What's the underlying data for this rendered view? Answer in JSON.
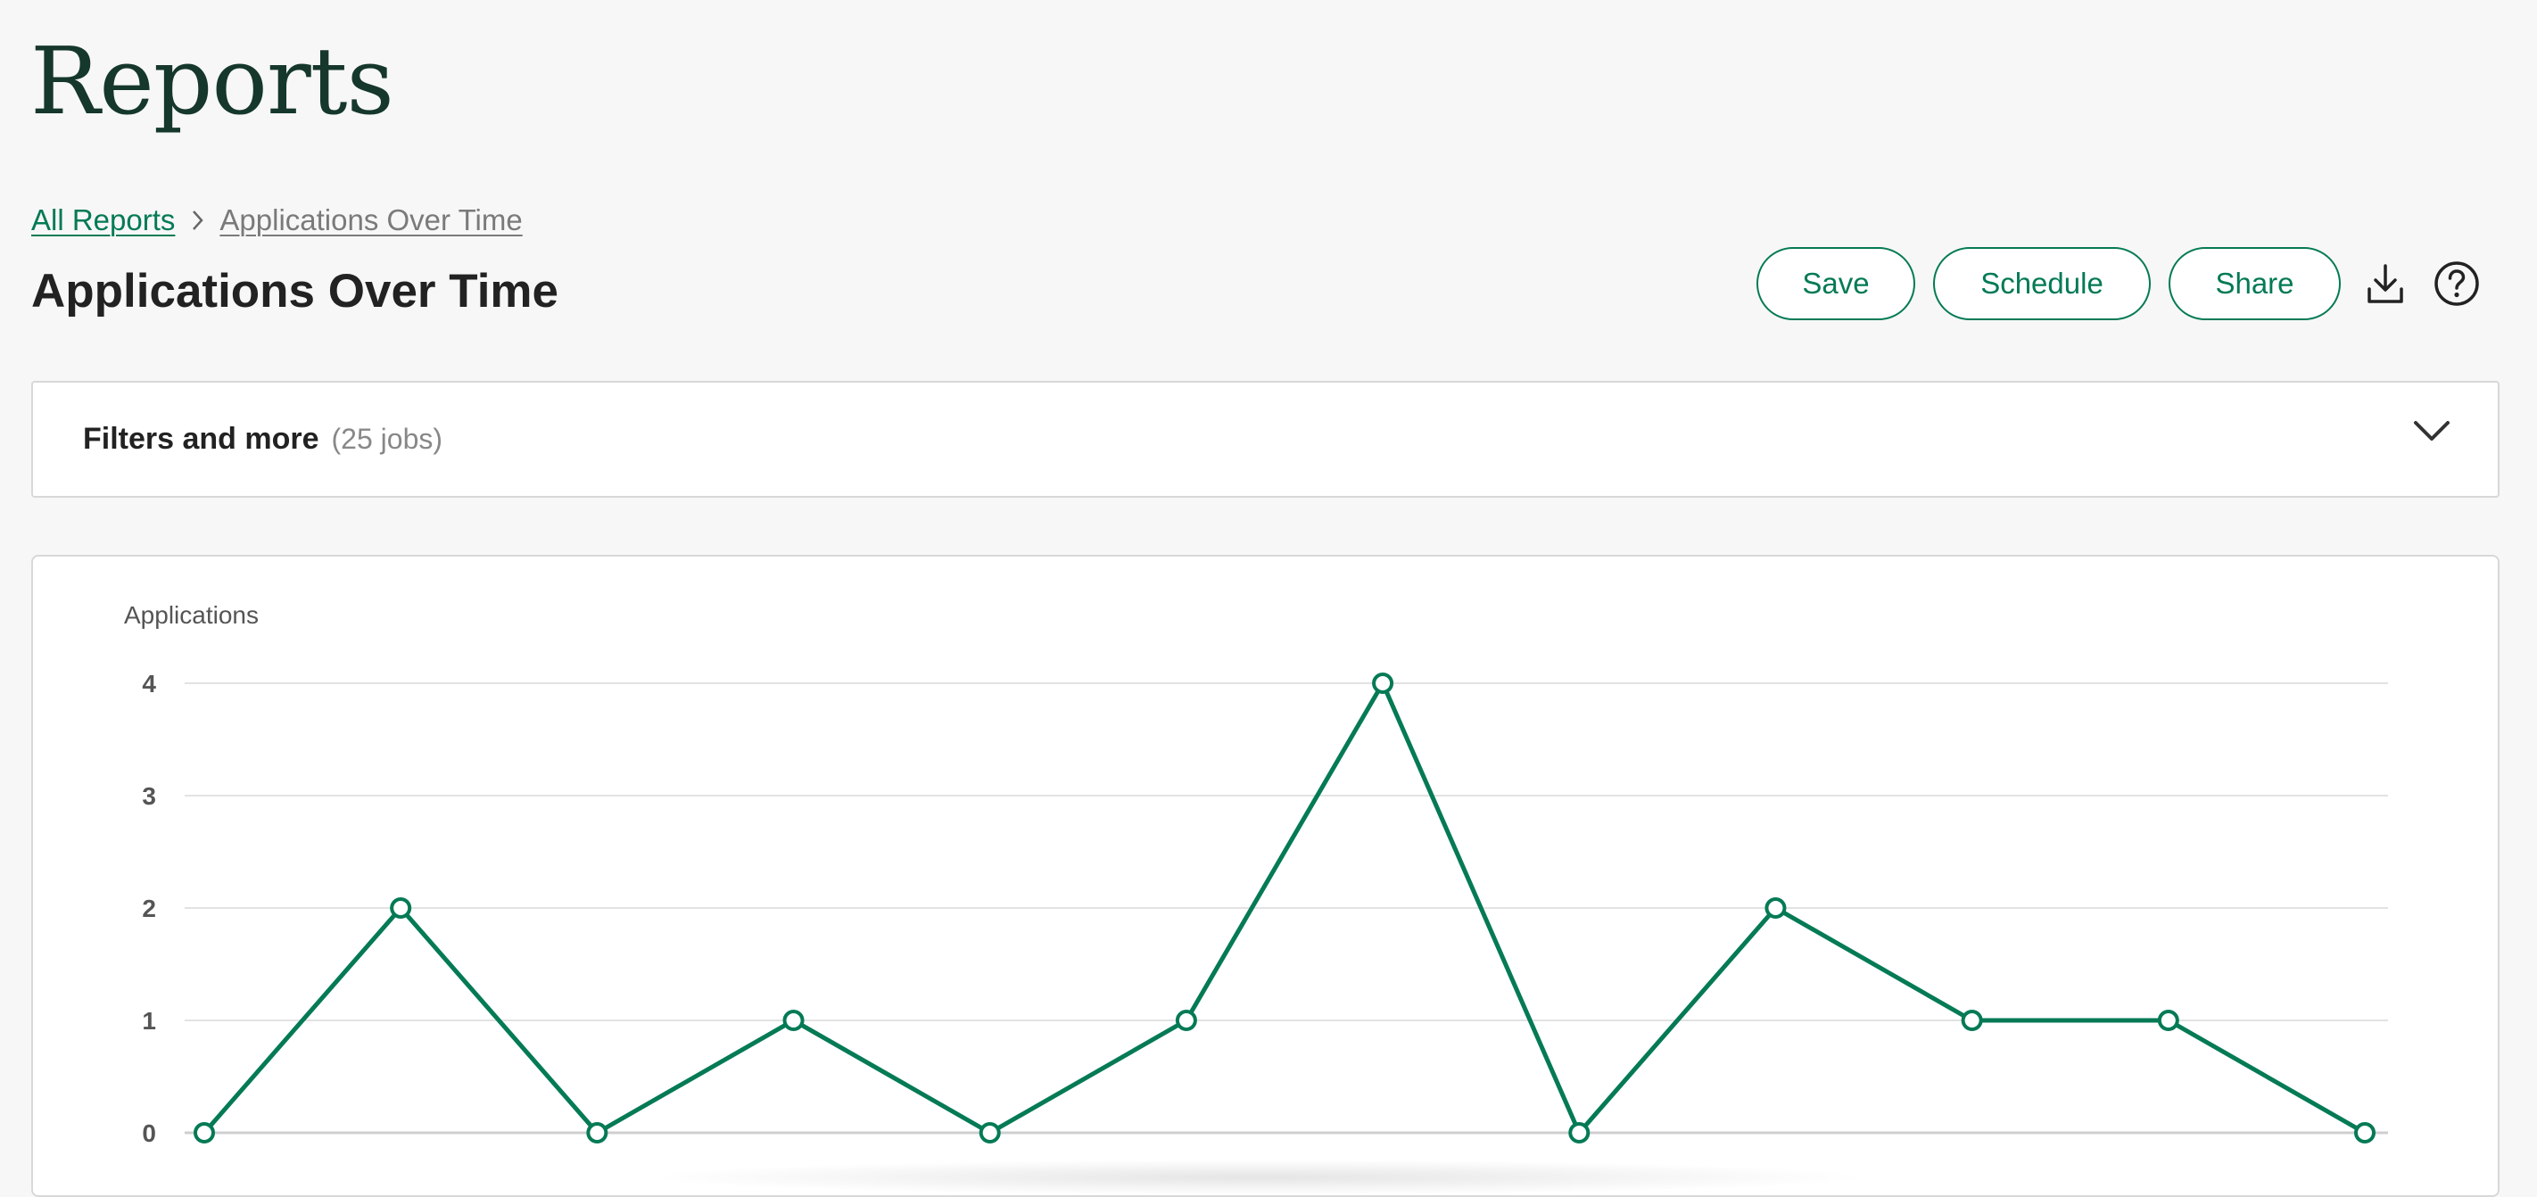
{
  "app": {
    "title": "Reports"
  },
  "breadcrumb": {
    "root": "All Reports",
    "current": "Applications Over Time"
  },
  "page": {
    "title": "Applications Over Time"
  },
  "toolbar": {
    "save_label": "Save",
    "schedule_label": "Schedule",
    "share_label": "Share",
    "download_icon": "download-icon",
    "help_icon": "help-icon"
  },
  "filters": {
    "label": "Filters and more",
    "count": "(25 jobs)"
  },
  "colors": {
    "accent": "#047a55",
    "title": "#15372c"
  },
  "chart_data": {
    "type": "line",
    "ylabel": "Applications",
    "ylim": [
      0,
      4
    ],
    "yticks": [
      "0",
      "1",
      "2",
      "3",
      "4"
    ],
    "series": [
      {
        "values": [
          0,
          2,
          0,
          1,
          0,
          1,
          4,
          0,
          2,
          1,
          1,
          0
        ]
      }
    ],
    "grid": true
  }
}
